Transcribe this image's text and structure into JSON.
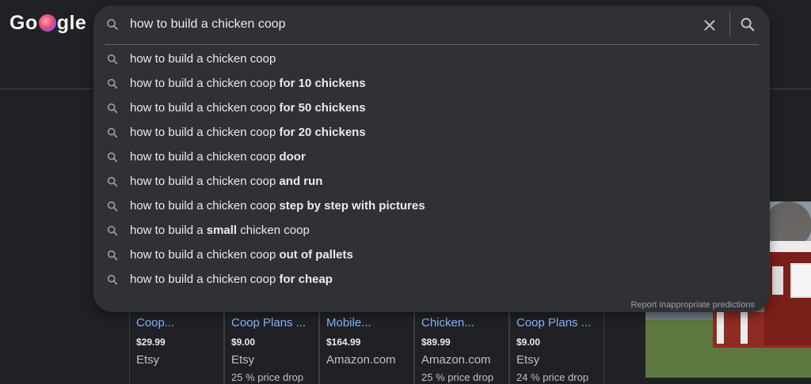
{
  "logo": {
    "pre": "Go",
    "post": "gle"
  },
  "search": {
    "query": "how to build a chicken coop",
    "suggestions": [
      {
        "pre": "how to build a chicken coop",
        "bold": "",
        "post": ""
      },
      {
        "pre": "how to build a chicken coop ",
        "bold": "for 10 chickens",
        "post": ""
      },
      {
        "pre": "how to build a chicken coop ",
        "bold": "for 50 chickens",
        "post": ""
      },
      {
        "pre": "how to build a chicken coop ",
        "bold": "for 20 chickens",
        "post": ""
      },
      {
        "pre": "how to build a chicken coop ",
        "bold": "door",
        "post": ""
      },
      {
        "pre": "how to build a chicken coop ",
        "bold": "and run",
        "post": ""
      },
      {
        "pre": "how to build a chicken coop ",
        "bold": "step by step with pictures",
        "post": ""
      },
      {
        "pre": "how to build a ",
        "bold": "small",
        "post": " chicken coop"
      },
      {
        "pre": "how to build a chicken coop ",
        "bold": "out of pallets",
        "post": ""
      },
      {
        "pre": "how to build a chicken coop ",
        "bold": "for cheap",
        "post": ""
      }
    ],
    "report_label": "Report inappropriate predictions"
  },
  "products": [
    {
      "title": "Coop...",
      "price": "$29.99",
      "store": "Etsy",
      "drop": ""
    },
    {
      "title": "Coop Plans ...",
      "price": "$9.00",
      "store": "Etsy",
      "drop": "25 % price drop"
    },
    {
      "title": "Mobile...",
      "price": "$164.99",
      "store": "Amazon.com",
      "drop": ""
    },
    {
      "title": "Chicken...",
      "price": "$89.99",
      "store": "Amazon.com",
      "drop": "25 % price drop"
    },
    {
      "title": "Coop Plans ...",
      "price": "$9.00",
      "store": "Etsy",
      "drop": "24 % price drop"
    }
  ]
}
